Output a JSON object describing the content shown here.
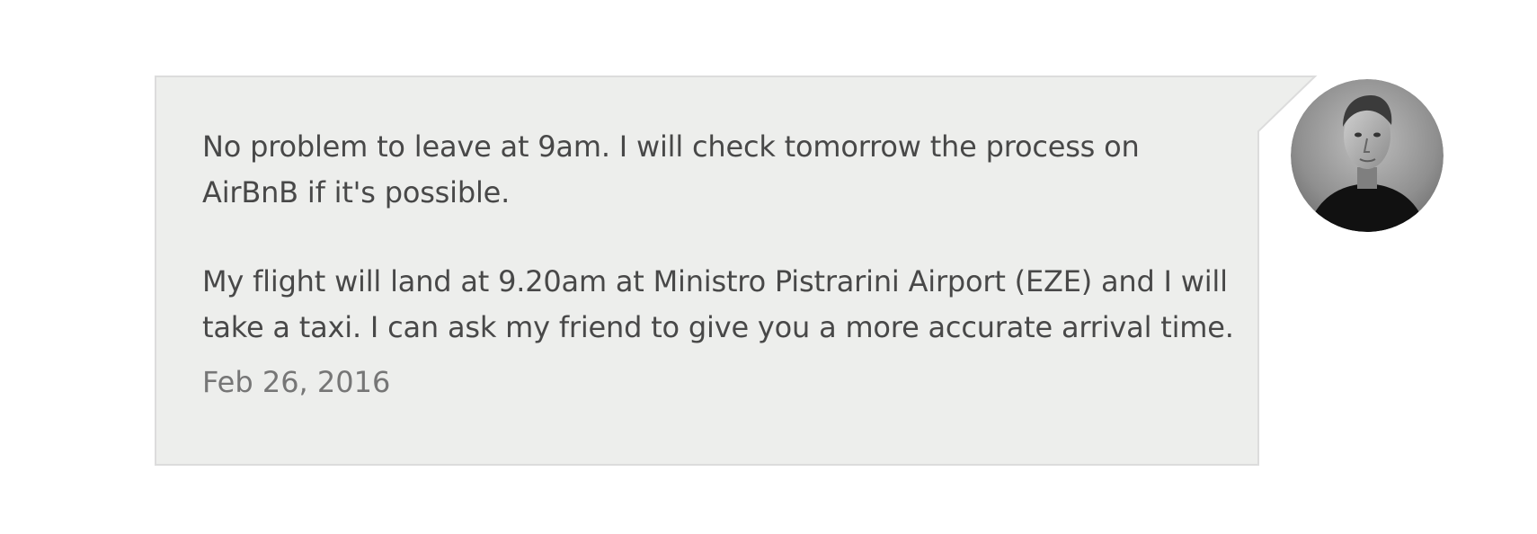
{
  "message": {
    "paragraphs": [
      "No problem to leave at 9am. I will check tomorrow the process on\nAirBnB if it's possible.",
      "My flight will land at 9.20am at Ministro Pistrarini Airport (EZE) and I will\ntake a taxi. I can ask my friend to give you a more accurate arrival time."
    ],
    "timestamp": "Feb 26, 2016"
  },
  "colors": {
    "bubble_background": "#edeeec",
    "bubble_border": "#dcdcdc",
    "text": "#484848",
    "timestamp": "#767676"
  },
  "avatar": {
    "icon": "user-photo-avatar"
  }
}
